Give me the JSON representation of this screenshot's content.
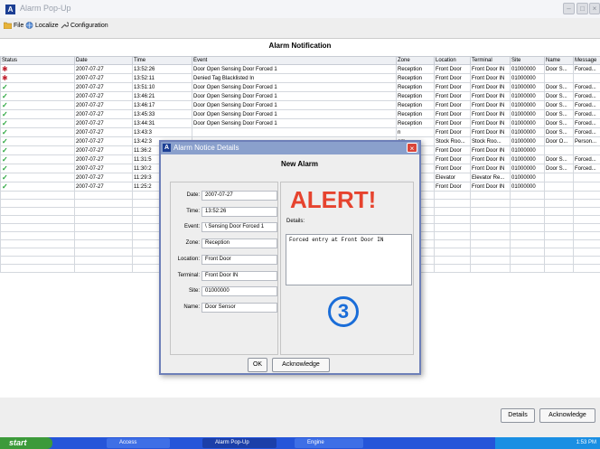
{
  "window": {
    "title": "Alarm Pop-Up",
    "icon_letter": "A"
  },
  "menu": [
    {
      "label": "File",
      "icon": "folder-icon"
    },
    {
      "label": "Localize",
      "icon": "globe-icon"
    },
    {
      "label": "Configuration",
      "icon": "wrench-icon"
    }
  ],
  "panel": {
    "title": "Alarm Notification"
  },
  "columns": [
    "Status",
    "Date",
    "Time",
    "Event",
    "Zone",
    "Location",
    "Terminal",
    "Site",
    "Name",
    "Message"
  ],
  "rows": [
    {
      "status": "alarm",
      "date": "2007-07-27",
      "time": "13:52:26",
      "event": "Door Open Sensing Door Forced 1",
      "zone": "Reception",
      "location": "Front Door",
      "terminal": "Front Door IN",
      "site": "01000000",
      "name": "Door S...",
      "message": "Forced..."
    },
    {
      "status": "alarm",
      "date": "2007-07-27",
      "time": "13:52:11",
      "event": "Denied Tag Blacklisted In",
      "zone": "Reception",
      "location": "Front Door",
      "terminal": "Front Door IN",
      "site": "01000000",
      "name": "",
      "message": ""
    },
    {
      "status": "ok",
      "date": "2007-07-27",
      "time": "13:51:10",
      "event": "Door Open Sensing Door Forced 1",
      "zone": "Reception",
      "location": "Front Door",
      "terminal": "Front Door IN",
      "site": "01000000",
      "name": "Door S...",
      "message": "Forced..."
    },
    {
      "status": "ok",
      "date": "2007-07-27",
      "time": "13:46:21",
      "event": "Door Open Sensing Door Forced 1",
      "zone": "Reception",
      "location": "Front Door",
      "terminal": "Front Door IN",
      "site": "01000000",
      "name": "Door S...",
      "message": "Forced..."
    },
    {
      "status": "ok",
      "date": "2007-07-27",
      "time": "13:46:17",
      "event": "Door Open Sensing Door Forced 1",
      "zone": "Reception",
      "location": "Front Door",
      "terminal": "Front Door IN",
      "site": "01000000",
      "name": "Door S...",
      "message": "Forced..."
    },
    {
      "status": "ok",
      "date": "2007-07-27",
      "time": "13:45:33",
      "event": "Door Open Sensing Door Forced 1",
      "zone": "Reception",
      "location": "Front Door",
      "terminal": "Front Door IN",
      "site": "01000000",
      "name": "Door S...",
      "message": "Forced..."
    },
    {
      "status": "ok",
      "date": "2007-07-27",
      "time": "13:44:31",
      "event": "Door Open Sensing Door Forced 1",
      "zone": "Reception",
      "location": "Front Door",
      "terminal": "Front Door IN",
      "site": "01000000",
      "name": "Door S...",
      "message": "Forced..."
    },
    {
      "status": "ok",
      "date": "2007-07-27",
      "time": "13:43:3",
      "event": "",
      "zone": "n",
      "location": "Front Door",
      "terminal": "Front Door IN",
      "site": "01000000",
      "name": "Door S...",
      "message": "Forced..."
    },
    {
      "status": "ok",
      "date": "2007-07-27",
      "time": "13:42:3",
      "event": "",
      "zone": "om",
      "location": "Stock Roo...",
      "terminal": "Stock Roo...",
      "site": "01000000",
      "name": "Door O...",
      "message": "Person..."
    },
    {
      "status": "ok",
      "date": "2007-07-27",
      "time": "11:36:2",
      "event": "",
      "zone": "n",
      "location": "Front Door",
      "terminal": "Front Door IN",
      "site": "01000000",
      "name": "",
      "message": ""
    },
    {
      "status": "ok",
      "date": "2007-07-27",
      "time": "11:31:5",
      "event": "",
      "zone": "n",
      "location": "Front Door",
      "terminal": "Front Door IN",
      "site": "01000000",
      "name": "Door S...",
      "message": "Forced..."
    },
    {
      "status": "ok",
      "date": "2007-07-27",
      "time": "11:30:2",
      "event": "",
      "zone": "n",
      "location": "Front Door",
      "terminal": "Front Door IN",
      "site": "01000000",
      "name": "Door S...",
      "message": "Forced..."
    },
    {
      "status": "ok",
      "date": "2007-07-27",
      "time": "11:29:3",
      "event": "",
      "zone": "n",
      "location": "Elevator",
      "terminal": "Elevator Re...",
      "site": "01000000",
      "name": "",
      "message": ""
    },
    {
      "status": "ok",
      "date": "2007-07-27",
      "time": "11:25:2",
      "event": "",
      "zone": "n",
      "location": "Front Door",
      "terminal": "Front Door IN",
      "site": "01000000",
      "name": "",
      "message": ""
    }
  ],
  "buttons": {
    "details": "Details",
    "acknowledge": "Acknowledge"
  },
  "dialog": {
    "title": "Alarm Notice Details",
    "heading": "New Alarm",
    "alert": "ALERT!",
    "details_label": "Details:",
    "details_text": "Forced entry at Front Door IN",
    "number": "3",
    "ok": "OK",
    "acknowledge": "Acknowledge",
    "fields": [
      {
        "label": "Date:",
        "value": "2007-07-27"
      },
      {
        "label": "Time:",
        "value": "13:52:26"
      },
      {
        "label": "Event:",
        "value": "\\ Sensing Door Forced 1"
      },
      {
        "label": "Zone:",
        "value": "Reception"
      },
      {
        "label": "Location:",
        "value": "Front Door"
      },
      {
        "label": "Terminal:",
        "value": "Front Door IN"
      },
      {
        "label": "Site:",
        "value": "01000000"
      },
      {
        "label": "Name:",
        "value": "Door Sensor"
      }
    ]
  },
  "taskbar": {
    "start": "start",
    "tasks": [
      "Access",
      "Alarm Pop-Up",
      "Engine"
    ],
    "clock": "1:53 PM"
  }
}
